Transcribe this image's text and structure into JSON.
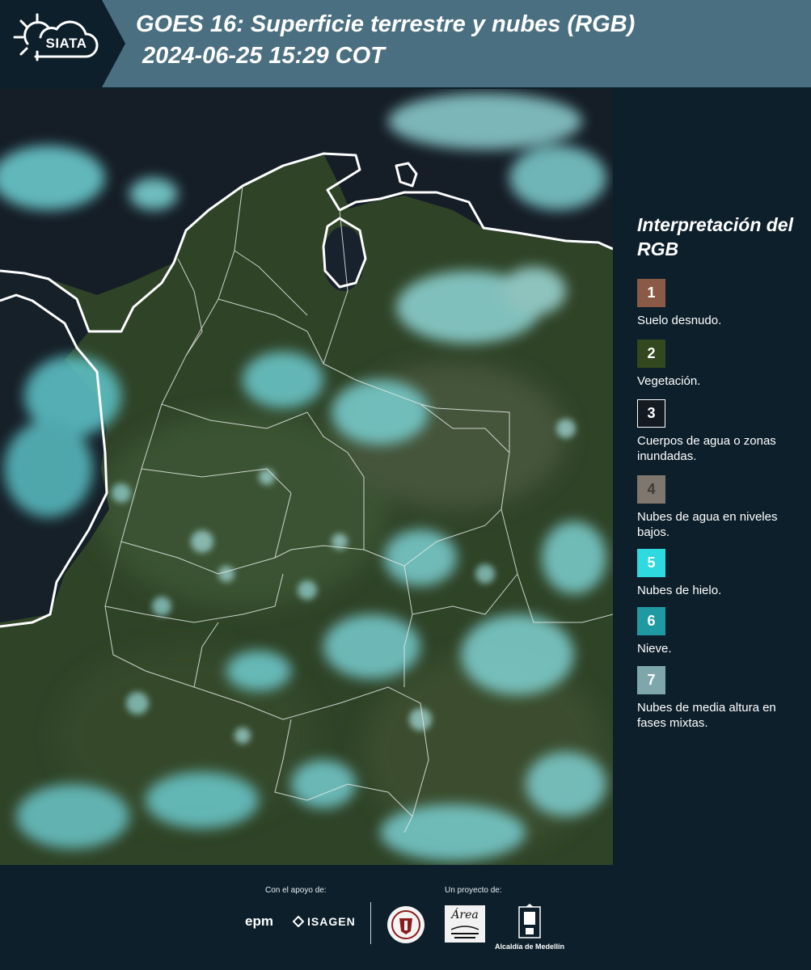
{
  "header": {
    "logo_text": "SIATA",
    "title_line_1": "GOES 16: Superficie terrestre y nubes (RGB)",
    "title_line_2": "2024-06-25 15:29 COT"
  },
  "map": {
    "icon": "satellite-rgb-map",
    "colors": {
      "vegetation": "#2f4327",
      "ice_cloud": "#6fd3d6",
      "low_cloud": "#9fb5b3",
      "water": "#151d26",
      "border": "#ffffff"
    }
  },
  "legend": {
    "title": "Interpretación del RGB",
    "items": [
      {
        "number": "1",
        "label": "Suelo desnudo.",
        "color": "#8a5a46"
      },
      {
        "number": "2",
        "label": "Vegetación.",
        "color": "#33481f"
      },
      {
        "number": "3",
        "label": "Cuerpos de agua o zonas inundadas.",
        "color": "#141a22"
      },
      {
        "number": "4",
        "label": "Nubes de agua en niveles bajos.",
        "color": "#7f776d"
      },
      {
        "number": "5",
        "label": "Nubes de hielo.",
        "color": "#2ed9df"
      },
      {
        "number": "6",
        "label": "Nieve.",
        "color": "#1f9aa3"
      },
      {
        "number": "7",
        "label": "Nubes de media altura en fases mixtas.",
        "color": "#7ea7ac"
      }
    ]
  },
  "footer": {
    "support_caption": "Con el apoyo de:",
    "project_caption": "Un proyecto de:",
    "epm_logo": "epm",
    "isagen_logo": "ISAGEN",
    "area_logo": "Área",
    "alcaldia_label": "Alcaldía de Medellín"
  }
}
